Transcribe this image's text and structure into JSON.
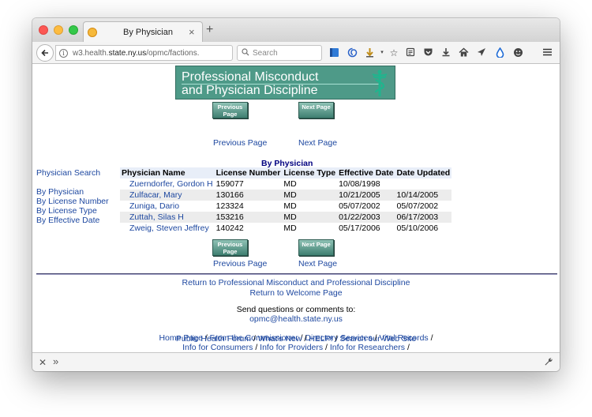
{
  "browser": {
    "tab_title": "By Physician",
    "tab_close": "×",
    "new_tab": "+",
    "url_prefix": "w3.health.",
    "url_domain": "state.ny.us",
    "url_path": "/opmc/factions.n",
    "search_placeholder": "Search"
  },
  "banner": {
    "line1": "Professional Misconduct",
    "line2": "and Physician Discipline"
  },
  "pager_top": {
    "prev_button": "Previous Page",
    "next_button": "Next Page",
    "prev_link": "Previous Page",
    "next_link": "Next Page"
  },
  "pager_bottom": {
    "prev_button": "Previous Page",
    "next_button": "Next Page",
    "prev_link": "Previous Page",
    "next_link": "Next Page"
  },
  "section_title": "By Physician",
  "sidebar": {
    "physician_search": "Physician Search",
    "by_physician": "By Physician",
    "by_license_number": "By License Number",
    "by_license_type": "By License Type",
    "by_effective_date": "By Effective Date"
  },
  "table": {
    "headers": [
      "Physician Name",
      "License Number",
      "License Type",
      "Effective Date",
      "Date Updated"
    ],
    "rows": [
      {
        "name": "Zuerndorfer, Gordon H",
        "license": "159077",
        "type": "MD",
        "effective": "10/08/1998",
        "updated": ""
      },
      {
        "name": "Zulfacar, Mary",
        "license": "130166",
        "type": "MD",
        "effective": "10/21/2005",
        "updated": "10/14/2005"
      },
      {
        "name": "Zuniga, Dario",
        "license": "123324",
        "type": "MD",
        "effective": "05/07/2002",
        "updated": "05/07/2002"
      },
      {
        "name": "Zuttah, Silas H",
        "license": "153216",
        "type": "MD",
        "effective": "01/22/2003",
        "updated": "06/17/2003"
      },
      {
        "name": "Zweig, Steven Jeffrey",
        "license": "140242",
        "type": "MD",
        "effective": "05/17/2006",
        "updated": "05/10/2006"
      }
    ]
  },
  "footer": {
    "return_opmc": "Return to Professional Misconduct and Professional Discipline",
    "return_welcome": "Return to Welcome Page",
    "send_questions": "Send questions or comments to:",
    "email": "opmc@health.state.ny.us",
    "links_row1": [
      "Home Page",
      "From the Commissioner",
      "Directory Services",
      "Vital Records"
    ],
    "links_row2": [
      "Info for Consumers",
      "Info for Providers",
      "Info for Researchers"
    ],
    "links_row3": [
      "Public Health Forum",
      "What's New",
      "HELP!",
      "Search our Web Site"
    ]
  },
  "colors": {
    "link": "#1e48a0",
    "banner": "#4e9a88",
    "title_navy": "#000080"
  }
}
